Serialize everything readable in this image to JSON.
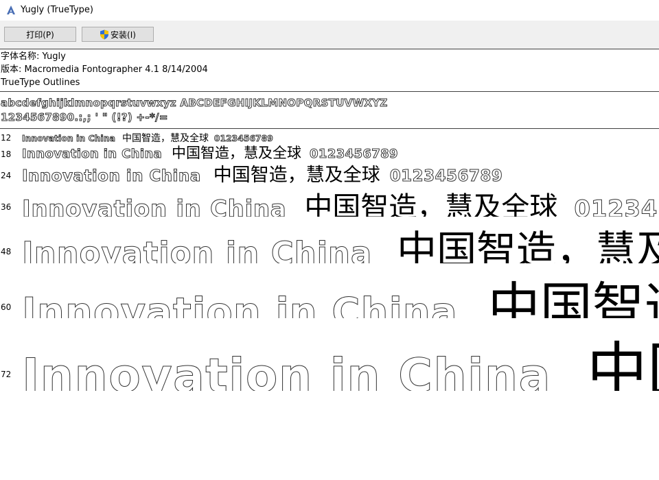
{
  "window": {
    "title": "Yugly (TrueType)",
    "icon": "font-viewer-icon"
  },
  "toolbar": {
    "print_label": "打印(P)",
    "install_label": "安装(I)"
  },
  "info": {
    "font_name": "字体名称: Yugly",
    "version": "版本: Macromedia Fontographer 4.1 8/14/2004",
    "outlines": "TrueType Outlines"
  },
  "charset": {
    "line1": "abcdefghijklmnopqrstuvwxyz  ABCDEFGHIJKLMNOPQRSTUVWXYZ",
    "line2": "1234567890.:,; ' \" (!?) +-*/="
  },
  "samples": {
    "latin": "Innovation in China",
    "cjk": "中国智造，慧及全球",
    "digits": "0123456789",
    "rows": [
      {
        "size": "12"
      },
      {
        "size": "18"
      },
      {
        "size": "24"
      },
      {
        "size": "36"
      },
      {
        "size": "48"
      },
      {
        "size": "60"
      },
      {
        "size": "72"
      }
    ]
  },
  "colors": {
    "toolbar_bg": "#f0f0f0",
    "button_bg": "#e1e1e1",
    "button_border": "#adadad"
  }
}
